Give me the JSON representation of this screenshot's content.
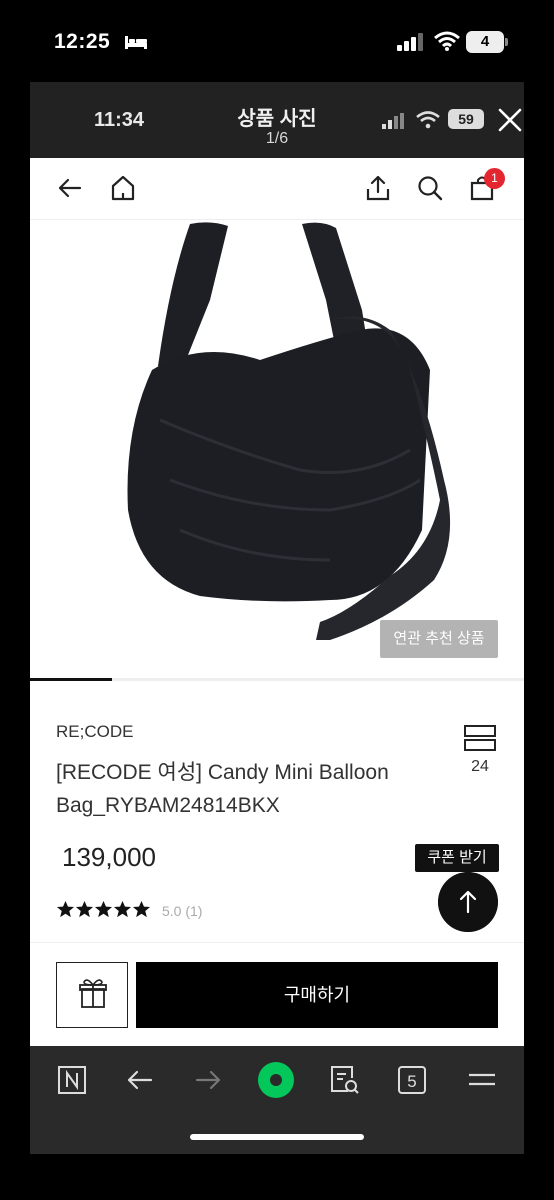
{
  "status_bar": {
    "time": "12:25",
    "battery": "4"
  },
  "photo_viewer": {
    "time": "11:34",
    "title": "상품 사진",
    "counter": "1/6",
    "battery": "59"
  },
  "product": {
    "related_label": "연관 추천 상품",
    "brand": "RE;CODE",
    "name": "[RECODE 여성] Candy Mini Balloon Bag_RYBAM24814BKX",
    "grid_count": "24",
    "price": "139,000",
    "coupon_label": "쿠폰 받기",
    "rating": 5,
    "rating_text": "5.0 (1)",
    "slide_progress": 0.167
  },
  "cart": {
    "badge": "1"
  },
  "actions": {
    "buy_label": "구매하기"
  },
  "browser": {
    "tabs_count": "5"
  },
  "colors": {
    "badge": "#e3262f",
    "naver_green": "#03c75a",
    "buy_bg": "#000000"
  }
}
